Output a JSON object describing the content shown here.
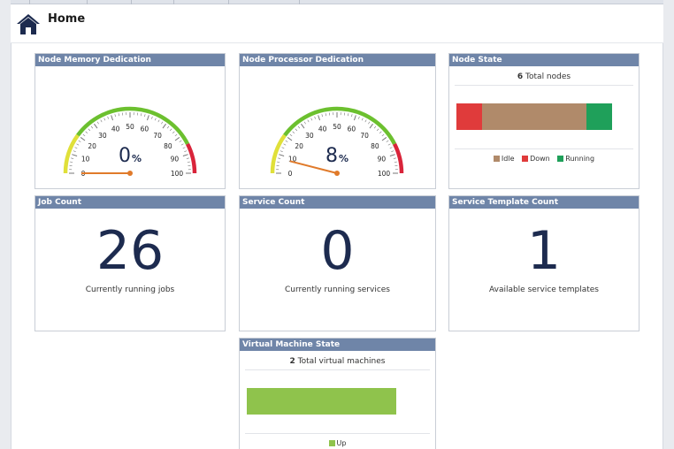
{
  "header": {
    "title": "Home"
  },
  "colors": {
    "panel_header": "#6f85a8",
    "number": "#1d2b4f",
    "idle": "#b08a6a",
    "down": "#e03b3b",
    "running": "#1fa05a",
    "up": "#8fc34c"
  },
  "panels": {
    "memory": {
      "title": "Node Memory Dedication",
      "value": "0",
      "unit": "%",
      "gauge_value": 0,
      "ticks": [
        "0",
        "10",
        "20",
        "30",
        "40",
        "50",
        "60",
        "70",
        "80",
        "90",
        "100"
      ]
    },
    "processor": {
      "title": "Node Processor Dedication",
      "value": "8",
      "unit": "%",
      "gauge_value": 8,
      "ticks": [
        "0",
        "10",
        "20",
        "30",
        "40",
        "50",
        "60",
        "70",
        "80",
        "90",
        "100"
      ]
    },
    "node_state": {
      "title": "Node State",
      "total_count": "6",
      "total_label": " Total nodes",
      "segments": [
        {
          "name": "Down",
          "value": 1
        },
        {
          "name": "Idle",
          "value": 4
        },
        {
          "name": "Running",
          "value": 1
        }
      ],
      "legend": [
        "Idle",
        "Down",
        "Running"
      ]
    },
    "job_count": {
      "title": "Job Count",
      "value": "26",
      "caption": "Currently running jobs"
    },
    "service_count": {
      "title": "Service Count",
      "value": "0",
      "caption": "Currently running services"
    },
    "service_template_count": {
      "title": "Service Template Count",
      "value": "1",
      "caption": "Available service templates"
    },
    "vm_state": {
      "title": "Virtual Machine State",
      "total_count": "2",
      "total_label": " Total virtual machines",
      "segments": [
        {
          "name": "Up",
          "value": 2
        }
      ],
      "legend": [
        "Up"
      ]
    }
  }
}
